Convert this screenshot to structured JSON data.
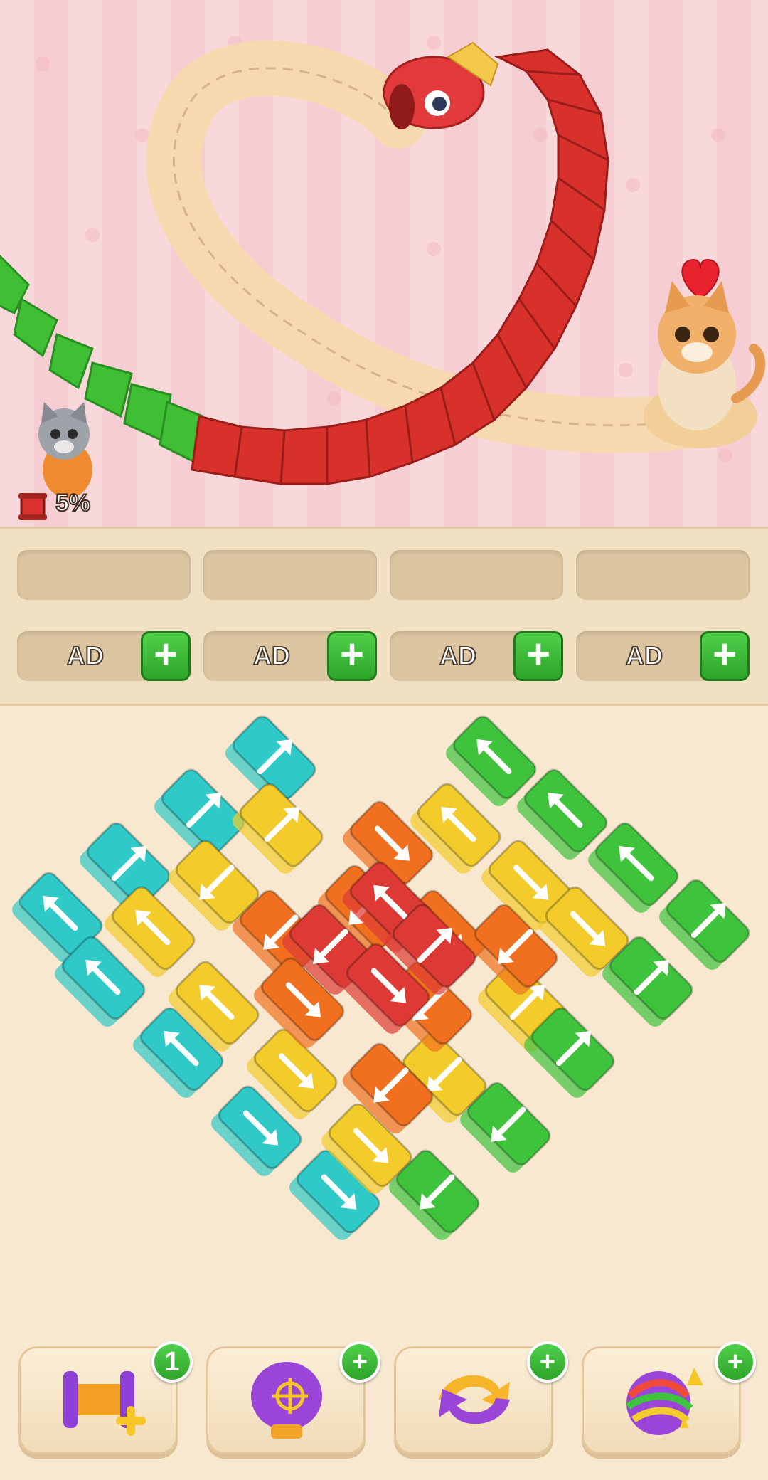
{
  "level": {
    "progress_text": "5%"
  },
  "tray": {
    "empty_slots": 4,
    "ad_slots": [
      {
        "label": "AD",
        "plus": "+"
      },
      {
        "label": "AD",
        "plus": "+"
      },
      {
        "label": "AD",
        "plus": "+"
      },
      {
        "label": "AD",
        "plus": "+"
      }
    ]
  },
  "boosters": [
    {
      "name": "spool-booster",
      "badge": "1"
    },
    {
      "name": "punch-booster",
      "badge": "+"
    },
    {
      "name": "shuffle-booster",
      "badge": "+"
    },
    {
      "name": "yarn-ball-booster",
      "badge": "+"
    }
  ],
  "colors": {
    "teal": "#2fc9c8",
    "yellow": "#f3cc2c",
    "orange": "#f0701f",
    "red": "#dd3a35",
    "green": "#3fc33c"
  },
  "board": {
    "tiles": [
      {
        "c": "teal",
        "dir": "ur"
      },
      {
        "c": "teal",
        "dir": "ur"
      },
      {
        "c": "teal",
        "dir": "ur"
      },
      {
        "c": "teal",
        "dir": "ul"
      },
      {
        "c": "teal",
        "dir": "ul"
      },
      {
        "c": "teal",
        "dir": "ul"
      },
      {
        "c": "teal",
        "dir": "dr"
      },
      {
        "c": "teal",
        "dir": "dr"
      },
      {
        "c": "yellow",
        "dir": "ur"
      },
      {
        "c": "yellow",
        "dir": "dl"
      },
      {
        "c": "yellow",
        "dir": "ul"
      },
      {
        "c": "yellow",
        "dir": "ul"
      },
      {
        "c": "yellow",
        "dir": "dr"
      },
      {
        "c": "yellow",
        "dir": "dr"
      },
      {
        "c": "yellow",
        "dir": "ul"
      },
      {
        "c": "yellow",
        "dir": "dr"
      },
      {
        "c": "yellow",
        "dir": "dr"
      },
      {
        "c": "yellow",
        "dir": "ur"
      },
      {
        "c": "yellow",
        "dir": "dl"
      },
      {
        "c": "orange",
        "dir": "dr"
      },
      {
        "c": "orange",
        "dir": "dl"
      },
      {
        "c": "orange",
        "dir": "dl"
      },
      {
        "c": "orange",
        "dir": "dr"
      },
      {
        "c": "orange",
        "dir": "dl"
      },
      {
        "c": "orange",
        "dir": "dr"
      },
      {
        "c": "orange",
        "dir": "dl"
      },
      {
        "c": "orange",
        "dir": "dl"
      },
      {
        "c": "red",
        "dir": "ul"
      },
      {
        "c": "red",
        "dir": "dl"
      },
      {
        "c": "red",
        "dir": "ur"
      },
      {
        "c": "red",
        "dir": "dr"
      },
      {
        "c": "green",
        "dir": "ul"
      },
      {
        "c": "green",
        "dir": "ul"
      },
      {
        "c": "green",
        "dir": "ul"
      },
      {
        "c": "green",
        "dir": "ur"
      },
      {
        "c": "green",
        "dir": "ur"
      },
      {
        "c": "green",
        "dir": "ur"
      },
      {
        "c": "green",
        "dir": "dl"
      },
      {
        "c": "green",
        "dir": "dl"
      }
    ]
  }
}
